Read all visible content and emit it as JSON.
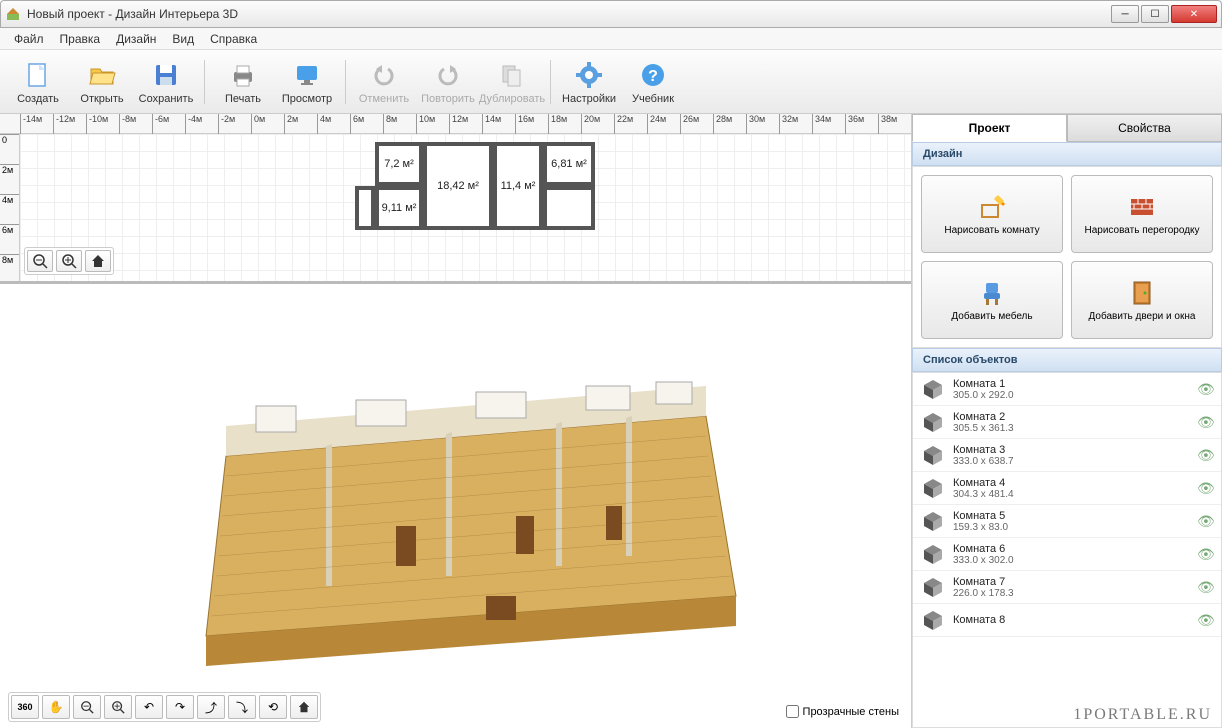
{
  "window": {
    "title": "Новый проект - Дизайн Интерьера 3D"
  },
  "menu": {
    "items": [
      "Файл",
      "Правка",
      "Дизайн",
      "Вид",
      "Справка"
    ]
  },
  "toolbar": {
    "create": "Создать",
    "open": "Открыть",
    "save": "Сохранить",
    "print": "Печать",
    "preview": "Просмотр",
    "undo": "Отменить",
    "redo": "Повторить",
    "duplicate": "Дублировать",
    "settings": "Настройки",
    "tutorial": "Учебник"
  },
  "ruler": {
    "h_ticks": [
      "-14м",
      "-12м",
      "-10м",
      "-8м",
      "-6м",
      "-4м",
      "-2м",
      "0м",
      "2м",
      "4м",
      "6м",
      "8м",
      "10м",
      "12м",
      "14м",
      "16м",
      "18м",
      "20м",
      "22м",
      "24м",
      "26м",
      "28м",
      "30м",
      "32м",
      "34м",
      "36м",
      "38м"
    ],
    "v_ticks": [
      "0",
      "2м",
      "4м",
      "6м",
      "8м"
    ]
  },
  "rooms_2d": [
    {
      "label": "7,2 м²"
    },
    {
      "label": "18,42 м²"
    },
    {
      "label": "11,4 м²"
    },
    {
      "label": "6,81 м²"
    },
    {
      "label": "9,11 м²"
    }
  ],
  "view3d": {
    "transparent_walls": "Прозрачные стены"
  },
  "sidebar": {
    "tabs": {
      "project": "Проект",
      "properties": "Свойства"
    },
    "design_header": "Дизайн",
    "buttons": {
      "draw_room": "Нарисовать комнату",
      "draw_partition": "Нарисовать перегородку",
      "add_furniture": "Добавить мебель",
      "add_doors": "Добавить двери и окна"
    },
    "objects_header": "Список объектов",
    "objects": [
      {
        "name": "Комната 1",
        "dim": "305.0 x 292.0"
      },
      {
        "name": "Комната 2",
        "dim": "305.5 x 361.3"
      },
      {
        "name": "Комната 3",
        "dim": "333.0 x 638.7"
      },
      {
        "name": "Комната 4",
        "dim": "304.3 x 481.4"
      },
      {
        "name": "Комната 5",
        "dim": "159.3 x 83.0"
      },
      {
        "name": "Комната 6",
        "dim": "333.0 x 302.0"
      },
      {
        "name": "Комната 7",
        "dim": "226.0 x 178.3"
      },
      {
        "name": "Комната 8",
        "dim": ""
      }
    ]
  },
  "watermark": "1PORTABLE.RU"
}
